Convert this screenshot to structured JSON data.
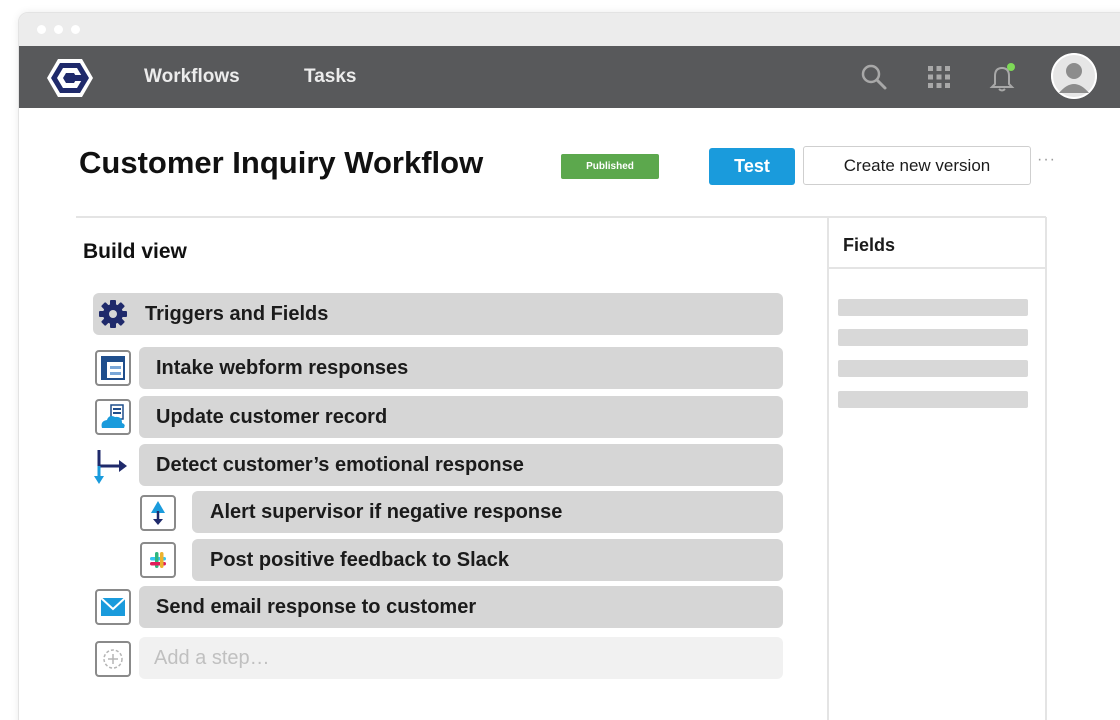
{
  "nav": {
    "links": [
      "Workflows",
      "Tasks"
    ]
  },
  "icons": {
    "logo": "app-logo-icon",
    "search": "search-icon",
    "apps": "apps-grid-icon",
    "notifications": "bell-icon",
    "avatar": "user-avatar-icon"
  },
  "header": {
    "title": "Customer Inquiry Workflow",
    "status_badge": "Published",
    "test_button": "Test",
    "new_version_button": "Create new version",
    "more": "···"
  },
  "build": {
    "title": "Build view",
    "steps": [
      {
        "label": "Triggers and Fields",
        "icon": "gear-icon"
      },
      {
        "label": "Intake webform responses",
        "icon": "webform-icon"
      },
      {
        "label": "Update customer record",
        "icon": "cloud-record-icon"
      },
      {
        "label": "Detect customer’s emotional response",
        "icon": "branch-arrow-icon"
      },
      {
        "label": "Alert supervisor if negative response",
        "icon": "alert-arrow-icon"
      },
      {
        "label": "Post positive feedback to Slack",
        "icon": "slack-icon"
      },
      {
        "label": "Send email response to customer",
        "icon": "email-icon"
      }
    ],
    "add_step_placeholder": "Add a step…"
  },
  "fields_panel": {
    "title": "Fields"
  },
  "colors": {
    "nav_bg": "#58595b",
    "accent_blue": "#1a9bdc",
    "published_green": "#5ca84d",
    "step_bg": "#d6d6d6",
    "logo_navy": "#1f2a6b"
  }
}
